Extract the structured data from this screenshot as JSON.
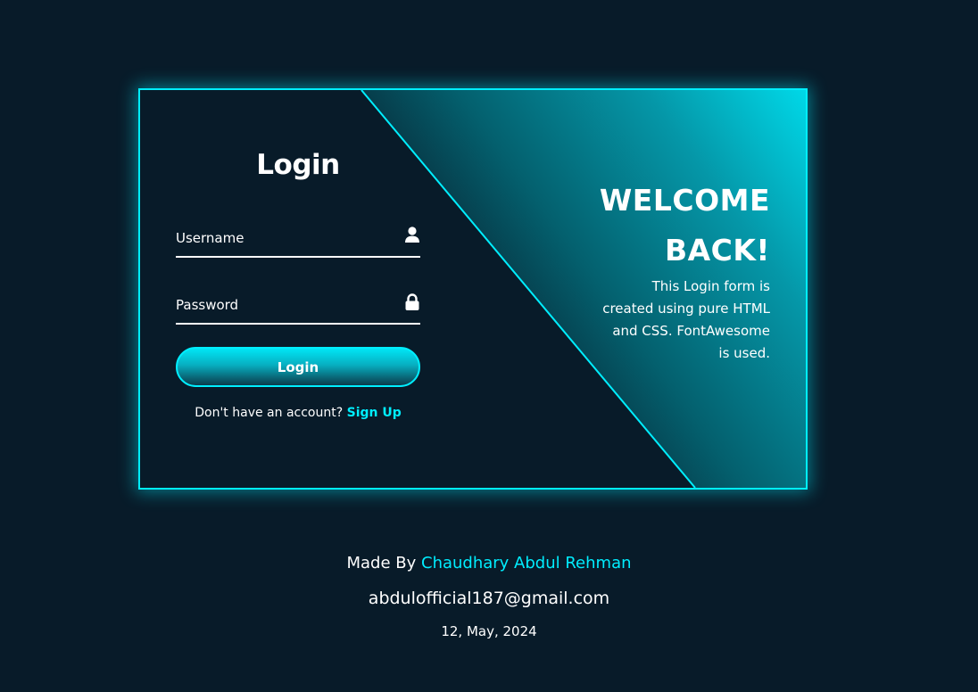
{
  "login": {
    "title": "Login",
    "username_placeholder": "Username",
    "password_placeholder": "Password",
    "button_label": "Login",
    "signup_prompt": "Don't have an account?",
    "signup_link": "Sign Up"
  },
  "info": {
    "heading": "WELCOME BACK!",
    "description": "This Login form is created using pure HTML and CSS. FontAwesome is used."
  },
  "footer": {
    "made_by_prefix": "Made By",
    "author": "Chaudhary Abdul Rehman",
    "email": "abdulofficial187@gmail.com",
    "date": "12, May, 2024"
  },
  "icons": {
    "username": "user-icon",
    "password": "lock-icon"
  },
  "colors": {
    "background": "#081b29",
    "accent": "#00eeff",
    "text": "#ffffff"
  }
}
